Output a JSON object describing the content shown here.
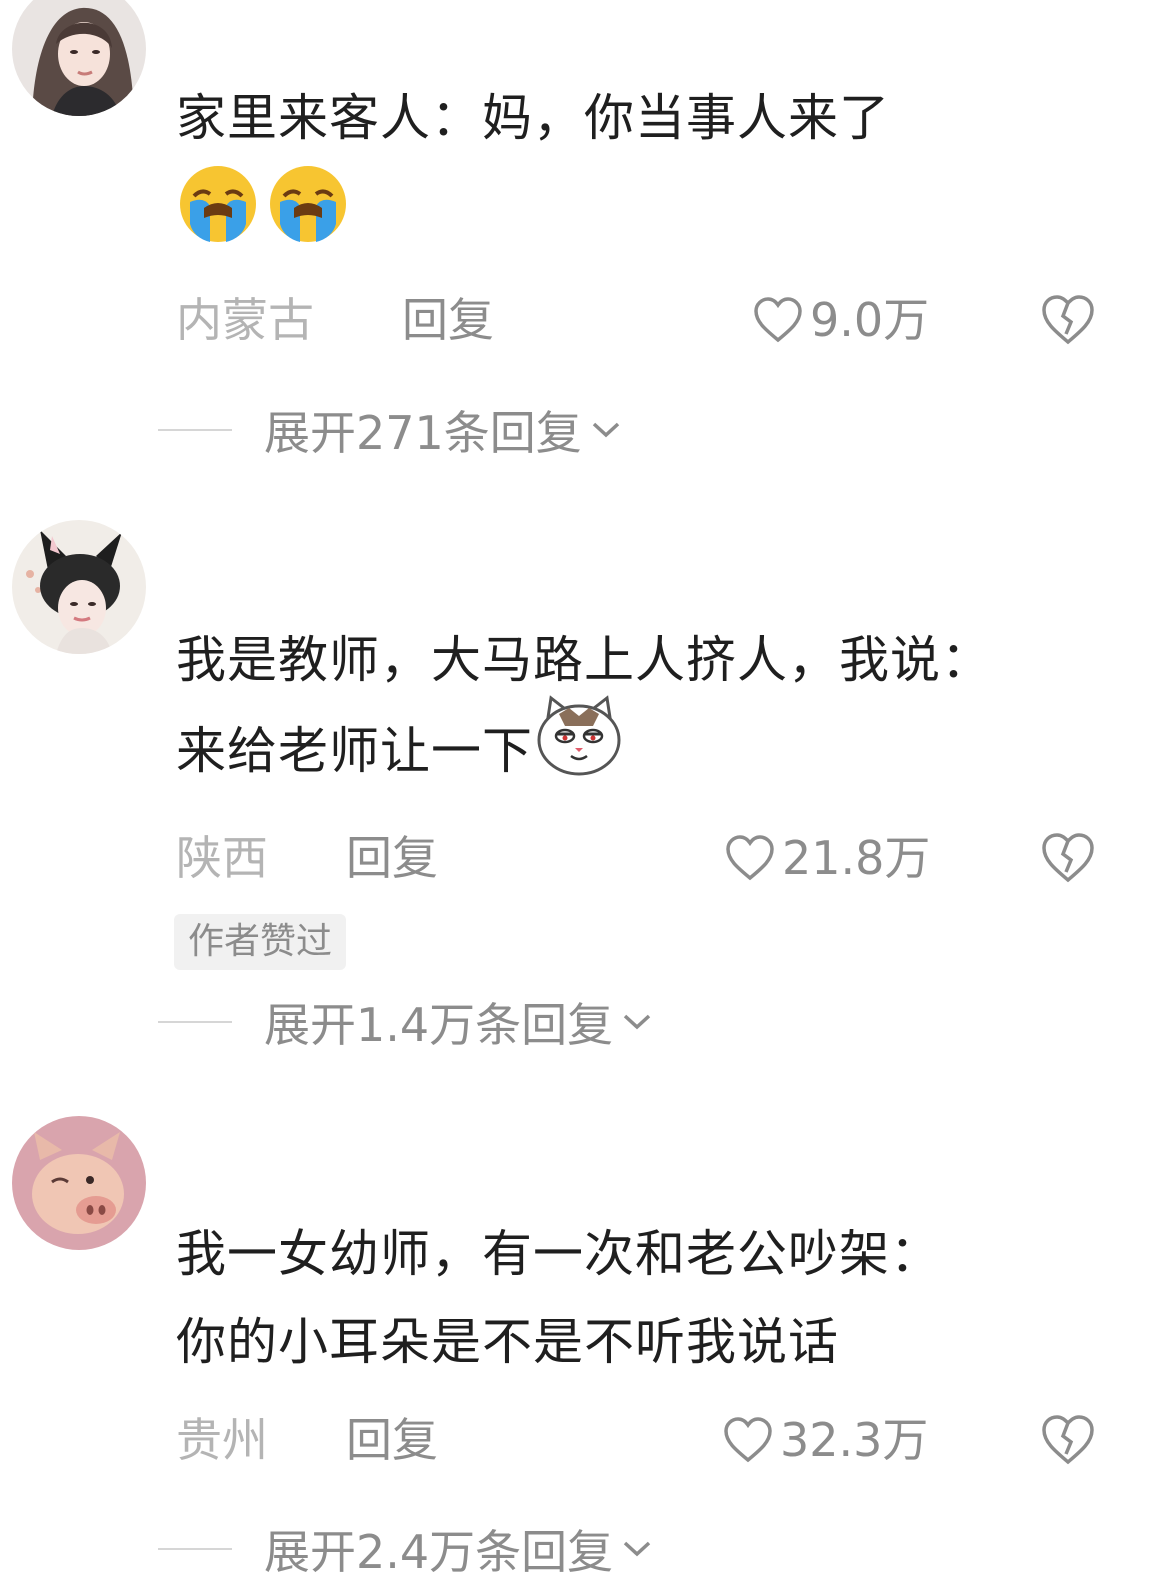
{
  "comments": [
    {
      "text_line1": "家里来客人：妈，你当事人来了",
      "location": "内蒙古",
      "reply_label": "回复",
      "likes": "9.0万",
      "expand_label": "展开271条回复"
    },
    {
      "text_line1": "我是教师，大马路上人挤人，我说：",
      "text_line2": "来给老师让一下",
      "location": "陕西",
      "reply_label": "回复",
      "likes": "21.8万",
      "badge": "作者赞过",
      "expand_label": "展开1.4万条回复"
    },
    {
      "text_line1": "我一女幼师，有一次和老公吵架：",
      "text_line2": "你的小耳朵是不是不听我说话",
      "location": "贵州",
      "reply_label": "回复",
      "likes": "32.3万",
      "expand_label": "展开2.4万条回复"
    }
  ],
  "icons": {
    "like": "heart-outline-icon",
    "dislike": "broken-heart-icon",
    "expand": "chevron-down-icon",
    "emoji_cry": "loudly-crying-face-emoji",
    "emoji_cat": "smug-cat-face-emoji"
  },
  "colors": {
    "text": "#1f1f1f",
    "muted": "#8c8c8c",
    "location": "#b4b4b4",
    "badge_bg": "#f1f1f1"
  }
}
